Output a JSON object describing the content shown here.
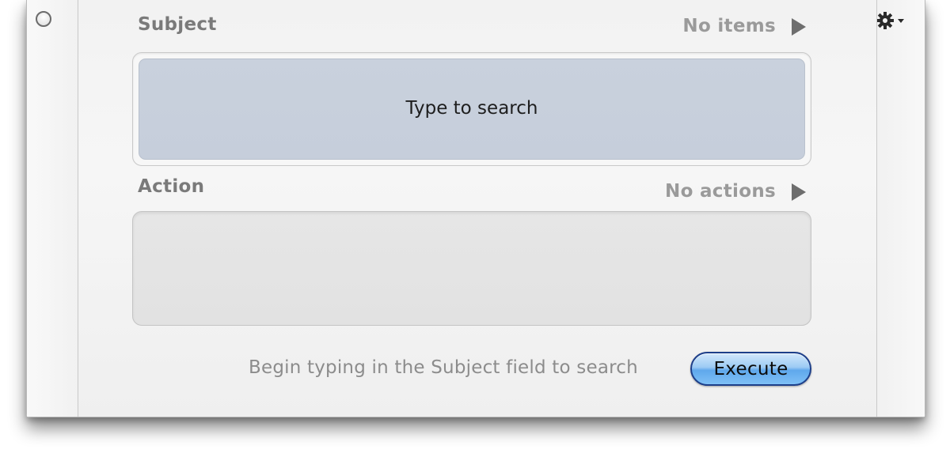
{
  "subject": {
    "label": "Subject",
    "count": "No items",
    "placeholder": "Type to search"
  },
  "action": {
    "label": "Action",
    "count": "No actions"
  },
  "footer": {
    "status": "Begin typing in the Subject field to search",
    "execute_label": "Execute"
  },
  "icons": {
    "close": "circle-close-icon",
    "settings": "gear-menu-icon",
    "disclosure": "triangle-right-icon"
  },
  "colors": {
    "subject_field_bg": "#c9d1dd",
    "execute_button": "#5fa8ec"
  }
}
